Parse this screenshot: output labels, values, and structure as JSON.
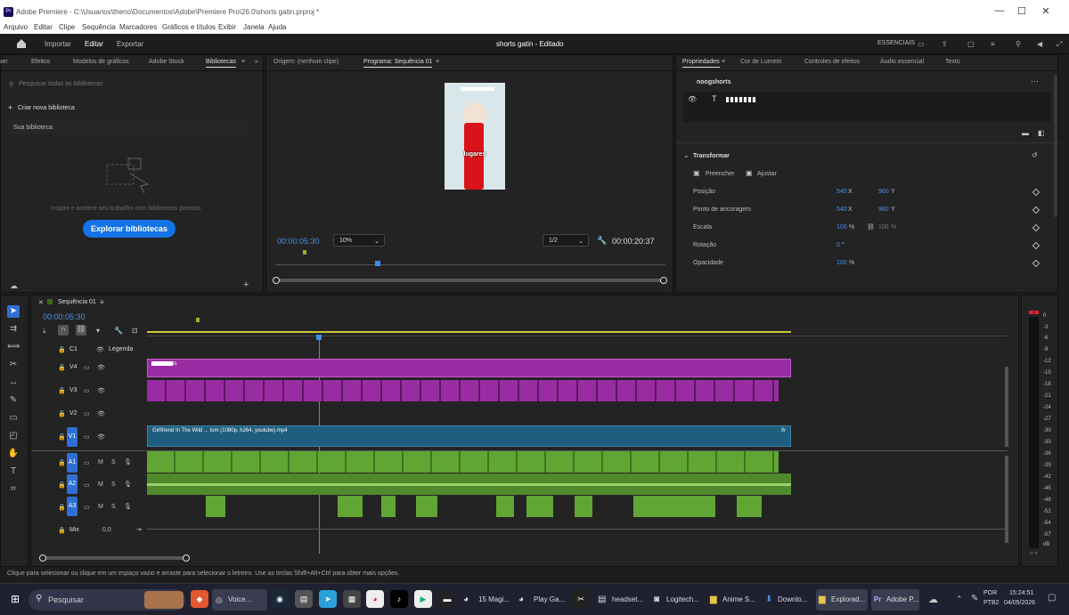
{
  "window": {
    "title": "Adobe Premiere - C:\\Usuarios\\theno\\Documentos\\Adobe\\Premiere Pro\\26.0\\shorts gatin.prproj *",
    "logo": "Pr"
  },
  "menu": [
    "Arquivo",
    "Editar",
    "Clipe",
    "Sequência",
    "Marcadores",
    "Gráficos e títulos",
    "Exibir",
    "Janela",
    "Ajuda"
  ],
  "header": {
    "home_icon": "home-icon",
    "tabs": [
      "Importar",
      "Editar",
      "Exportar"
    ],
    "active_tab": "Editar",
    "project": "shorts gatin - Editado",
    "workspace": "ESSENCIAIS"
  },
  "left_panel": {
    "tabs": [
      "ser",
      "Efeitos",
      "Modelos de gráficos",
      "Adobe Stock",
      "Bibliotecas"
    ],
    "active": "Bibliotecas",
    "search_placeholder": "Pesquisar todas as bibliotecas",
    "create": "Criar nova biblioteca",
    "my_library": "Sua biblioteca",
    "inspire": "Inspire e acelere seu trabalho com bibliotecas prontas.",
    "explore": "Explorar bibliotecas"
  },
  "program_panel": {
    "source_tab": "Origem: (nenhum clipe)",
    "program_tab": "Programa: Sequência 01",
    "timecode": "00:00:05:30",
    "zoom": "10%",
    "quality": "1/2",
    "duration": "00:00:20:37",
    "overlay_text": "lugares"
  },
  "props_panel": {
    "tabs": [
      "Propriedades",
      "Cor de Lumetri",
      "Controles de efeitos",
      "Áudio essencial",
      "Texto"
    ],
    "active": "Propriedades",
    "clip_name": "noogshorts",
    "section": "Transformar",
    "fill": "Preencher",
    "fit": "Ajustar",
    "rows": [
      {
        "label": "Posição",
        "v1": "540",
        "u1": "X",
        "v2": "960",
        "u2": "Y"
      },
      {
        "label": "Ponto de ancoragem",
        "v1": "540",
        "u1": "X",
        "v2": "960",
        "u2": "Y"
      },
      {
        "label": "Escala",
        "v1": "100",
        "u1": "%",
        "v2": "100",
        "u2": "%"
      },
      {
        "label": "Rotação",
        "v1": "0",
        "u1": "°",
        "v2": "",
        "u2": ""
      },
      {
        "label": "Opacidade",
        "v1": "100",
        "u1": "%",
        "v2": "",
        "u2": ""
      }
    ]
  },
  "timeline": {
    "sequence": "Sequência 01",
    "timecode": "00:00:05:30",
    "caption_track": "C1",
    "caption_label": "Legenda",
    "video_tracks": [
      "V4",
      "V3",
      "V2",
      "V1"
    ],
    "audio_tracks": [
      "A1",
      "A2",
      "A3"
    ],
    "mix_label": "Mix",
    "mix_value": "0,0",
    "v4_clip": "ts",
    "v1_clip": "Girlfriend In The Wild ... tom (1080p, h264, youtube).mp4"
  },
  "meter_labels": [
    "0",
    "-3",
    "-6",
    "-9",
    "-12",
    "-15",
    "-18",
    "-21",
    "-24",
    "-27",
    "-30",
    "-33",
    "-36",
    "-39",
    "-42",
    "-45",
    "-48",
    "-51",
    "-54",
    "-57",
    "dB"
  ],
  "status": "Clique para selecionar ou clique em um espaço vazio e arraste para selecionar o letreiro. Use as teclas Shift+Alt+Ctrl para obter mais opções.",
  "taskbar": {
    "search": "Pesquisar",
    "apps": [
      "Voice...",
      "15 Magi...",
      "Play Ga...",
      "headset...",
      "Logitech...",
      "Anime S...",
      "Downlo...",
      "Explorad...",
      "Adobe P..."
    ],
    "lang": "POR",
    "layout": "PTB2",
    "time": "15:24:51",
    "date": "04/05/2026"
  }
}
